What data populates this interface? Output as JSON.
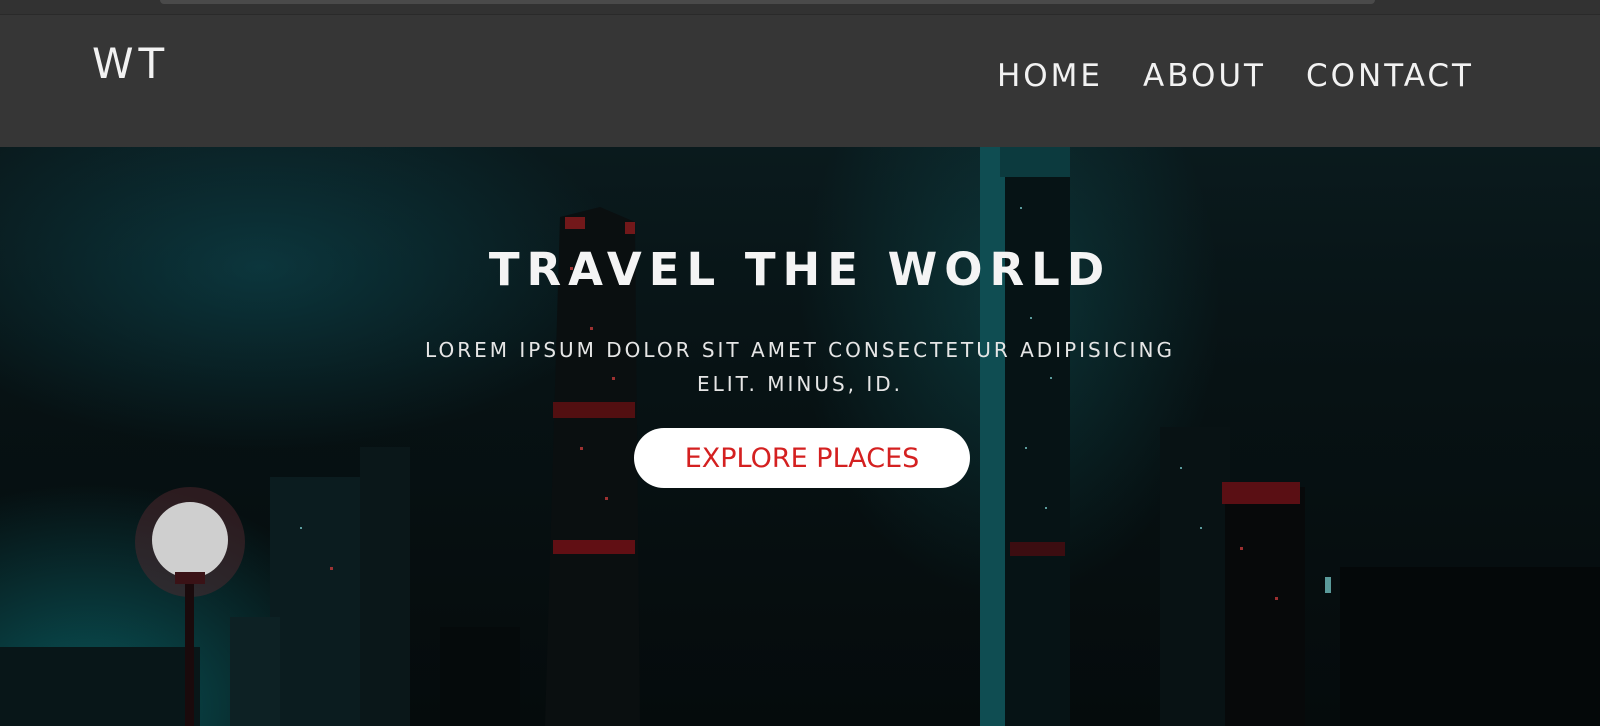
{
  "brand": {
    "logo_text": "WT"
  },
  "nav": {
    "items": [
      {
        "label": "HOME"
      },
      {
        "label": "ABOUT"
      },
      {
        "label": "CONTACT"
      }
    ]
  },
  "hero": {
    "title": "TRAVEL THE WORLD",
    "subtitle": "LOREM IPSUM DOLOR SIT AMET CONSECTETUR ADIPISICING ELIT. MINUS, ID.",
    "cta_label": "EXPLORE PLACES",
    "background_image": "night city skyline"
  },
  "colors": {
    "navbar_bg": "#363636",
    "cta_text": "#d42020",
    "cta_bg": "#ffffff",
    "text_light": "#f4f4f4"
  }
}
